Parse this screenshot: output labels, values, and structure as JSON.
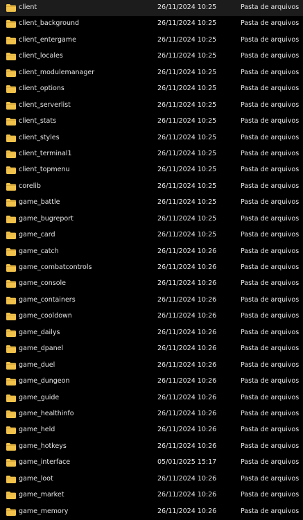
{
  "colors": {
    "background": "#000000",
    "text": "#e6e6e6",
    "folder": "#f0c24b"
  },
  "icons": {
    "folder": "folder-icon"
  },
  "files": [
    {
      "name": "client",
      "date": "26/11/2024 10:25",
      "type": "Pasta de arquivos"
    },
    {
      "name": "client_background",
      "date": "26/11/2024 10:25",
      "type": "Pasta de arquivos"
    },
    {
      "name": "client_entergame",
      "date": "26/11/2024 10:25",
      "type": "Pasta de arquivos"
    },
    {
      "name": "client_locales",
      "date": "26/11/2024 10:25",
      "type": "Pasta de arquivos"
    },
    {
      "name": "client_modulemanager",
      "date": "26/11/2024 10:25",
      "type": "Pasta de arquivos"
    },
    {
      "name": "client_options",
      "date": "26/11/2024 10:25",
      "type": "Pasta de arquivos"
    },
    {
      "name": "client_serverlist",
      "date": "26/11/2024 10:25",
      "type": "Pasta de arquivos"
    },
    {
      "name": "client_stats",
      "date": "26/11/2024 10:25",
      "type": "Pasta de arquivos"
    },
    {
      "name": "client_styles",
      "date": "26/11/2024 10:25",
      "type": "Pasta de arquivos"
    },
    {
      "name": "client_terminal1",
      "date": "26/11/2024 10:25",
      "type": "Pasta de arquivos"
    },
    {
      "name": "client_topmenu",
      "date": "26/11/2024 10:25",
      "type": "Pasta de arquivos"
    },
    {
      "name": "corelib",
      "date": "26/11/2024 10:25",
      "type": "Pasta de arquivos"
    },
    {
      "name": "game_battle",
      "date": "26/11/2024 10:25",
      "type": "Pasta de arquivos"
    },
    {
      "name": "game_bugreport",
      "date": "26/11/2024 10:25",
      "type": "Pasta de arquivos"
    },
    {
      "name": "game_card",
      "date": "26/11/2024 10:25",
      "type": "Pasta de arquivos"
    },
    {
      "name": "game_catch",
      "date": "26/11/2024 10:26",
      "type": "Pasta de arquivos"
    },
    {
      "name": "game_combatcontrols",
      "date": "26/11/2024 10:26",
      "type": "Pasta de arquivos"
    },
    {
      "name": "game_console",
      "date": "26/11/2024 10:26",
      "type": "Pasta de arquivos"
    },
    {
      "name": "game_containers",
      "date": "26/11/2024 10:26",
      "type": "Pasta de arquivos"
    },
    {
      "name": "game_cooldown",
      "date": "26/11/2024 10:26",
      "type": "Pasta de arquivos"
    },
    {
      "name": "game_dailys",
      "date": "26/11/2024 10:26",
      "type": "Pasta de arquivos"
    },
    {
      "name": "game_dpanel",
      "date": "26/11/2024 10:26",
      "type": "Pasta de arquivos"
    },
    {
      "name": "game_duel",
      "date": "26/11/2024 10:26",
      "type": "Pasta de arquivos"
    },
    {
      "name": "game_dungeon",
      "date": "26/11/2024 10:26",
      "type": "Pasta de arquivos"
    },
    {
      "name": "game_guide",
      "date": "26/11/2024 10:26",
      "type": "Pasta de arquivos"
    },
    {
      "name": "game_healthinfo",
      "date": "26/11/2024 10:26",
      "type": "Pasta de arquivos"
    },
    {
      "name": "game_held",
      "date": "26/11/2024 10:26",
      "type": "Pasta de arquivos"
    },
    {
      "name": "game_hotkeys",
      "date": "26/11/2024 10:26",
      "type": "Pasta de arquivos"
    },
    {
      "name": "game_interface",
      "date": "05/01/2025 15:17",
      "type": "Pasta de arquivos"
    },
    {
      "name": "game_loot",
      "date": "26/11/2024 10:26",
      "type": "Pasta de arquivos"
    },
    {
      "name": "game_market",
      "date": "26/11/2024 10:26",
      "type": "Pasta de arquivos"
    },
    {
      "name": "game_memory",
      "date": "26/11/2024 10:26",
      "type": "Pasta de arquivos"
    }
  ]
}
